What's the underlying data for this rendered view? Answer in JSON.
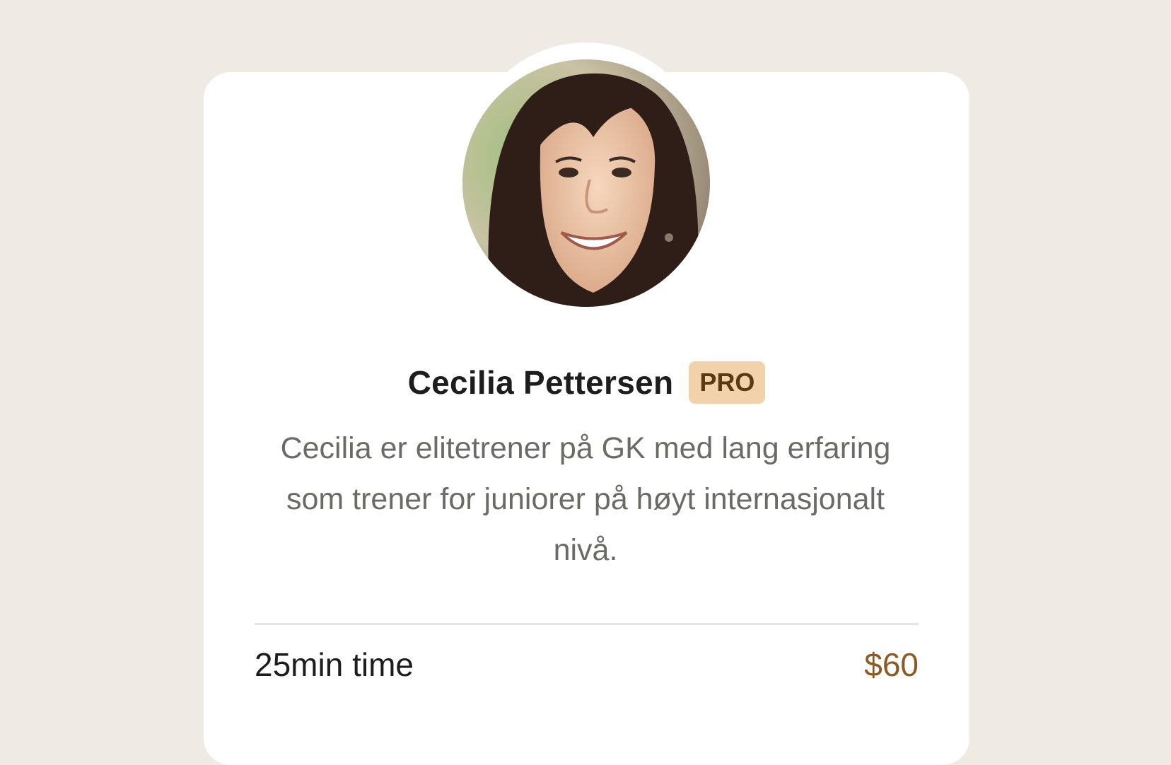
{
  "profile": {
    "name": "Cecilia Pettersen",
    "badge": "PRO",
    "bio": "Cecilia er elitetrener på GK med lang erfaring som trener for juniorer på høyt internasjonalt nivå.",
    "avatar_alt": "Cecilia Pettersen"
  },
  "session": {
    "label": "25min time",
    "price": "$60"
  },
  "colors": {
    "background": "#efebe4",
    "card": "#ffffff",
    "badge_bg": "#f2d2aa",
    "badge_text": "#5a3a10",
    "price": "#8b5a25"
  }
}
